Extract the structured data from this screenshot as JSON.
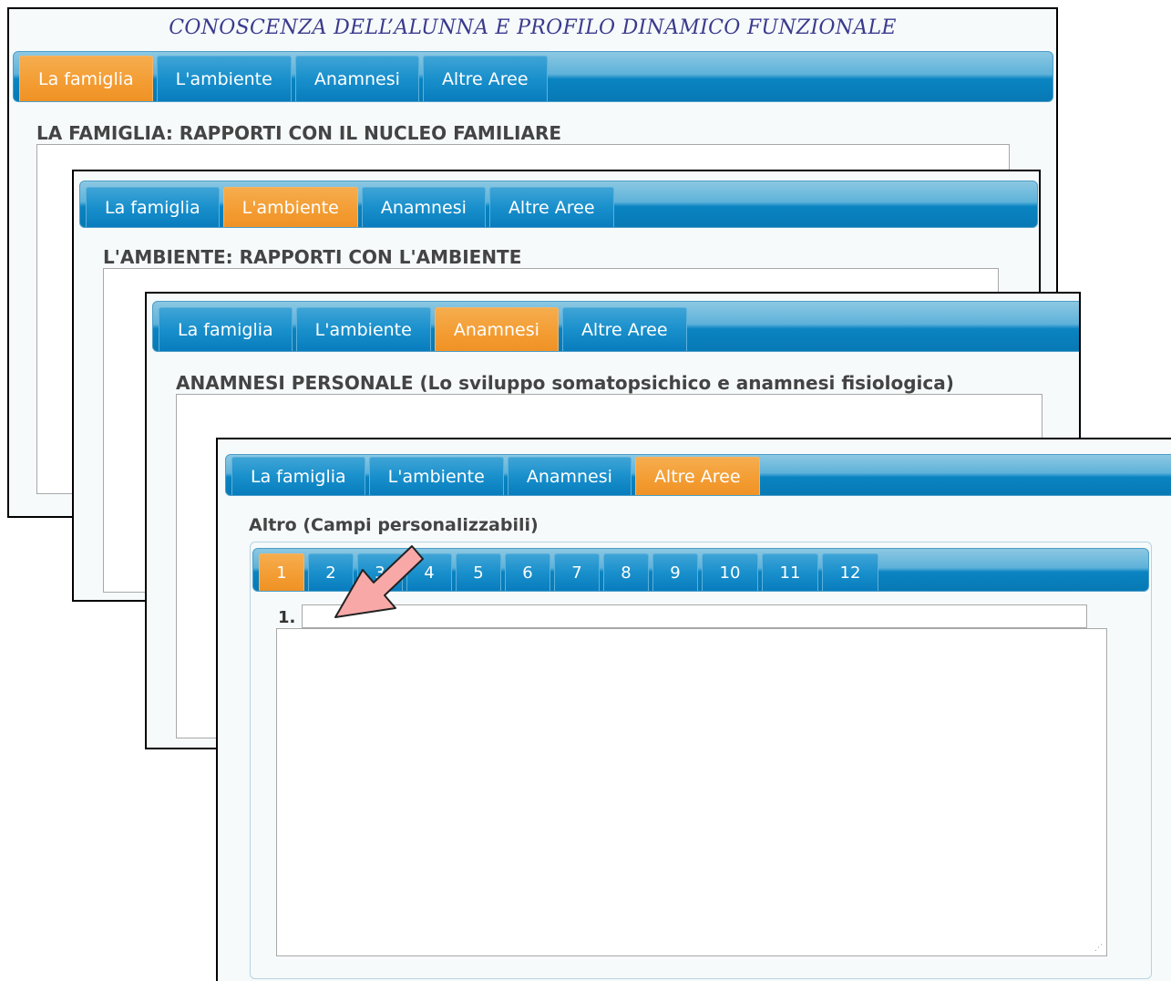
{
  "page": {
    "main_title": "CONOSCENZA DELL’ALUNNA E PROFILO DINAMICO FUNZIONALE"
  },
  "tabs": [
    "La famiglia",
    "L'ambiente",
    "Anamnesi",
    "Altre Aree"
  ],
  "panel1": {
    "active_tab": "La famiglia",
    "section_title": "LA FAMIGLIA: RAPPORTI CON IL NUCLEO FAMILIARE"
  },
  "panel2": {
    "active_tab": "L'ambiente",
    "section_title": "L'AMBIENTE: RAPPORTI CON L'AMBIENTE"
  },
  "panel3": {
    "active_tab": "Anamnesi",
    "section_title": "ANAMNESI PERSONALE (Lo sviluppo somatopsichico e anamnesi fisiologica)"
  },
  "panel4": {
    "active_tab": "Altre Aree",
    "section_title": "Altro (Campi personalizzabili)",
    "number_tabs": [
      "1",
      "2",
      "3",
      "4",
      "5",
      "6",
      "7",
      "8",
      "9",
      "10",
      "11",
      "12"
    ],
    "active_number": "1",
    "field_label": "1.",
    "title_value": "",
    "text_value": ""
  },
  "colors": {
    "tab_active": "#f39c32",
    "tab_inactive": "#1990cc",
    "title_color": "#3a3a8c",
    "arrow_fill": "#f9a8a8"
  },
  "icons": {
    "arrow": "pointer-arrow-icon",
    "resize": "resize-grip-icon"
  }
}
